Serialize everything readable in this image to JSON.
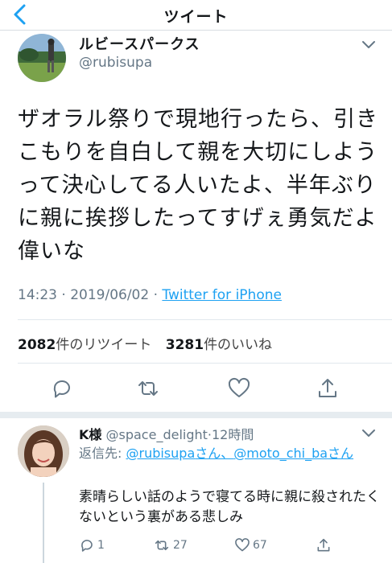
{
  "nav": {
    "title": "ツイート"
  },
  "tweet": {
    "name": "ルビースパークス",
    "handle": "@rubisupa",
    "text": "ザオラル祭りで現地行ったら、引きこもりを自白して親を大切にしようって決心してる人いたよ、半年ぶりに親に挨拶したってすげぇ勇気だよ偉いな",
    "time": "14:23 · 2019/06/02 · ",
    "source": "Twitter for iPhone",
    "retweet_count": "2082",
    "retweet_label": "件のリツイート",
    "like_count": "3281",
    "like_label": "件のいいね"
  },
  "reply": {
    "name": "K様",
    "handle": "@space_delight",
    "time": "·12時間",
    "replying_prefix": "返信先: ",
    "replying_user1": "@rubisupa",
    "replying_mid": "さん、",
    "replying_user2": "@moto_chi_ba",
    "replying_suffix": "さん",
    "text": "素晴らしい話のようで寝てる時に親に殺されたくないという裏がある悲しみ",
    "reply_count": "1",
    "retweet_count": "27",
    "like_count": "67"
  },
  "colors": {
    "link": "#1da1f2",
    "muted": "#657786",
    "separator": "#e6ecf0"
  },
  "icons": [
    "back-chevron-icon",
    "chevron-down-icon",
    "reply-icon",
    "retweet-icon",
    "like-icon",
    "share-icon"
  ]
}
